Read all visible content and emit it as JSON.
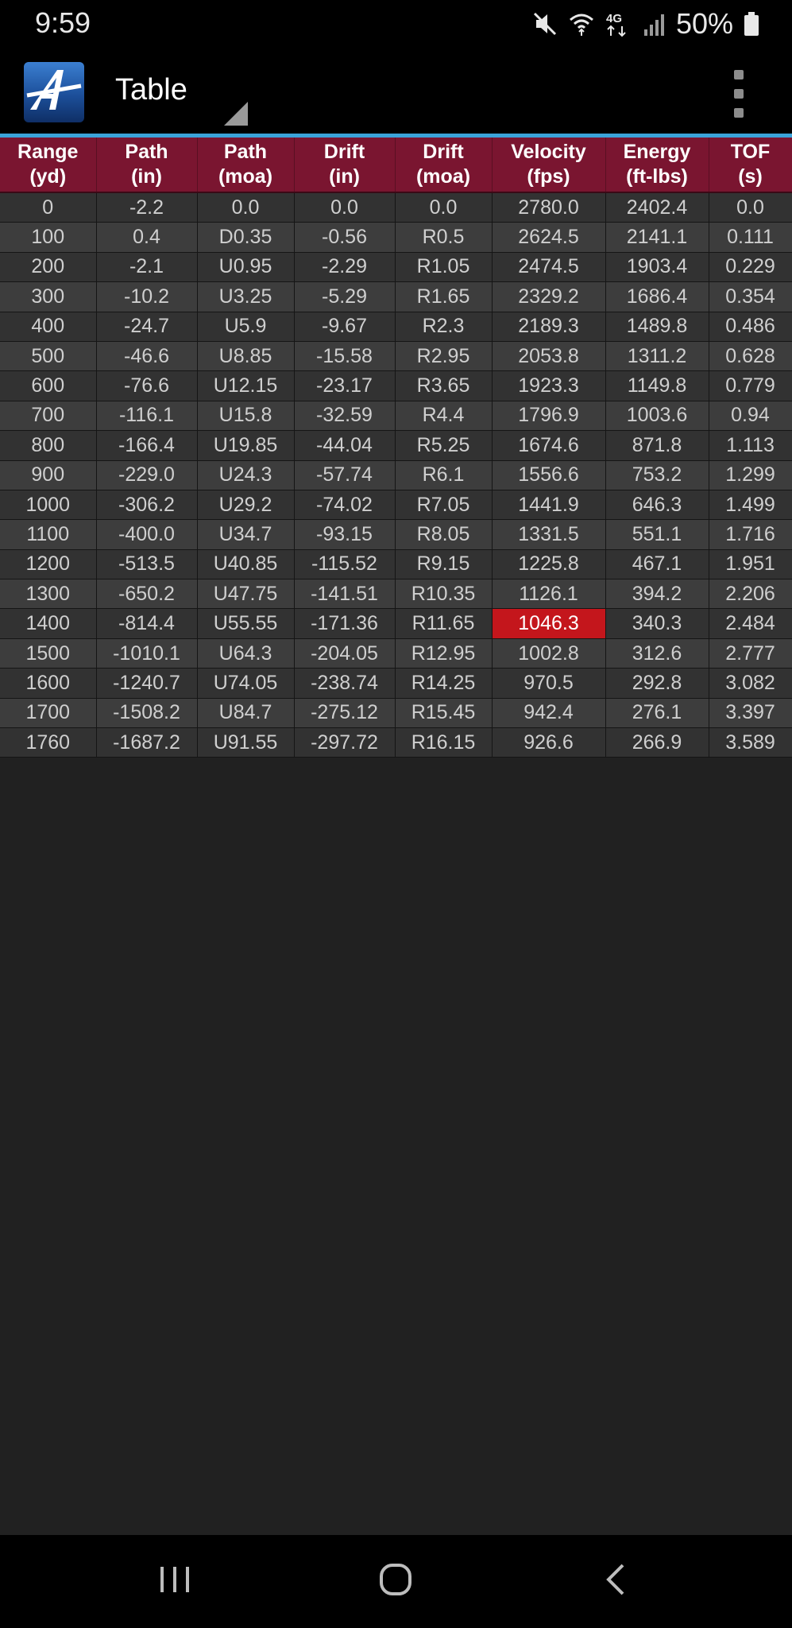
{
  "status_bar": {
    "time": "9:59",
    "icons": [
      "mute-icon",
      "wifi-icon",
      "lte-icon",
      "signal-icon",
      "battery-icon"
    ],
    "network_label": "4G",
    "battery_text": "50%"
  },
  "app_bar": {
    "title": "Table",
    "logo_icon": "app-logo-icon",
    "menu_icon": "overflow-menu-icon"
  },
  "colors": {
    "header_bg": "#7a1530",
    "row_odd": "#323232",
    "row_even": "#3d3d3d",
    "highlight": "#c4161c",
    "accent_line": "#3ba3d9",
    "background": "#212121"
  },
  "table": {
    "columns": [
      {
        "line1": "Range",
        "line2": "(yd)"
      },
      {
        "line1": "Path",
        "line2": "(in)"
      },
      {
        "line1": "Path",
        "line2": "(moa)"
      },
      {
        "line1": "Drift",
        "line2": "(in)"
      },
      {
        "line1": "Drift",
        "line2": "(moa)"
      },
      {
        "line1": "Velocity",
        "line2": "(fps)"
      },
      {
        "line1": "Energy",
        "line2": "(ft-lbs)"
      },
      {
        "line1": "TOF",
        "line2": "(s)"
      }
    ],
    "rows": [
      [
        "0",
        "-2.2",
        "0.0",
        "0.0",
        "0.0",
        "2780.0",
        "2402.4",
        "0.0"
      ],
      [
        "100",
        "0.4",
        "D0.35",
        "-0.56",
        "R0.5",
        "2624.5",
        "2141.1",
        "0.111"
      ],
      [
        "200",
        "-2.1",
        "U0.95",
        "-2.29",
        "R1.05",
        "2474.5",
        "1903.4",
        "0.229"
      ],
      [
        "300",
        "-10.2",
        "U3.25",
        "-5.29",
        "R1.65",
        "2329.2",
        "1686.4",
        "0.354"
      ],
      [
        "400",
        "-24.7",
        "U5.9",
        "-9.67",
        "R2.3",
        "2189.3",
        "1489.8",
        "0.486"
      ],
      [
        "500",
        "-46.6",
        "U8.85",
        "-15.58",
        "R2.95",
        "2053.8",
        "1311.2",
        "0.628"
      ],
      [
        "600",
        "-76.6",
        "U12.15",
        "-23.17",
        "R3.65",
        "1923.3",
        "1149.8",
        "0.779"
      ],
      [
        "700",
        "-116.1",
        "U15.8",
        "-32.59",
        "R4.4",
        "1796.9",
        "1003.6",
        "0.94"
      ],
      [
        "800",
        "-166.4",
        "U19.85",
        "-44.04",
        "R5.25",
        "1674.6",
        "871.8",
        "1.113"
      ],
      [
        "900",
        "-229.0",
        "U24.3",
        "-57.74",
        "R6.1",
        "1556.6",
        "753.2",
        "1.299"
      ],
      [
        "1000",
        "-306.2",
        "U29.2",
        "-74.02",
        "R7.05",
        "1441.9",
        "646.3",
        "1.499"
      ],
      [
        "1100",
        "-400.0",
        "U34.7",
        "-93.15",
        "R8.05",
        "1331.5",
        "551.1",
        "1.716"
      ],
      [
        "1200",
        "-513.5",
        "U40.85",
        "-115.52",
        "R9.15",
        "1225.8",
        "467.1",
        "1.951"
      ],
      [
        "1300",
        "-650.2",
        "U47.75",
        "-141.51",
        "R10.35",
        "1126.1",
        "394.2",
        "2.206"
      ],
      [
        "1400",
        "-814.4",
        "U55.55",
        "-171.36",
        "R11.65",
        "1046.3",
        "340.3",
        "2.484"
      ],
      [
        "1500",
        "-1010.1",
        "U64.3",
        "-204.05",
        "R12.95",
        "1002.8",
        "312.6",
        "2.777"
      ],
      [
        "1600",
        "-1240.7",
        "U74.05",
        "-238.74",
        "R14.25",
        "970.5",
        "292.8",
        "3.082"
      ],
      [
        "1700",
        "-1508.2",
        "U84.7",
        "-275.12",
        "R15.45",
        "942.4",
        "276.1",
        "3.397"
      ],
      [
        "1760",
        "-1687.2",
        "U91.55",
        "-297.72",
        "R16.15",
        "926.6",
        "266.9",
        "3.589"
      ]
    ],
    "highlighted_cell": {
      "row": 14,
      "col": 5
    }
  },
  "nav_bar": {
    "recents_icon": "recents-icon",
    "home_icon": "home-icon",
    "back_icon": "back-icon"
  }
}
